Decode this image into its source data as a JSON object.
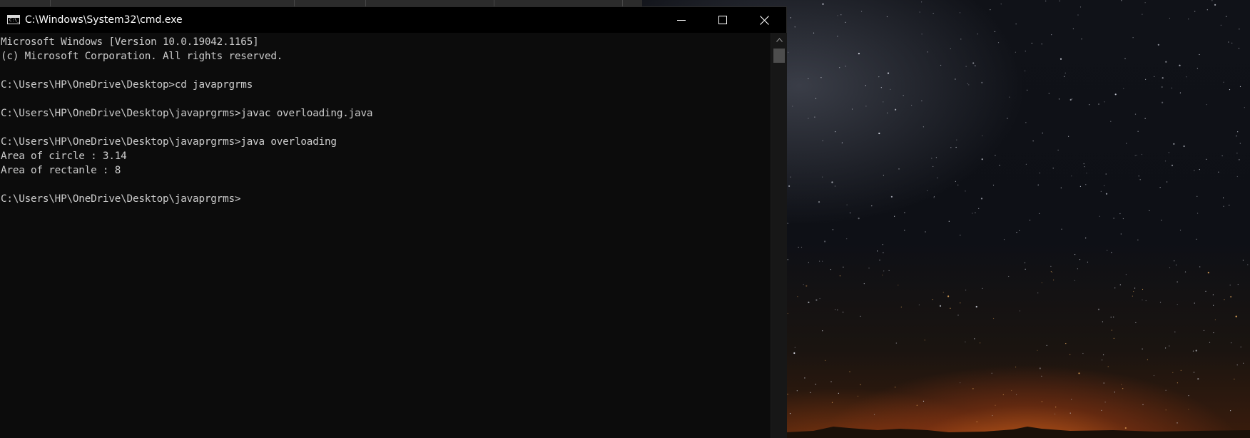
{
  "window": {
    "title": "C:\\Windows\\System32\\cmd.exe",
    "icon": "cmd-prompt-icon",
    "icon_glyph": "C:\\_",
    "controls": [
      "minimize-icon",
      "maximize-icon",
      "close-icon"
    ]
  },
  "console": {
    "lines": [
      "Microsoft Windows [Version 10.0.19042.1165]",
      "(c) Microsoft Corporation. All rights reserved.",
      "",
      "C:\\Users\\HP\\OneDrive\\Desktop>cd javaprgrms",
      "",
      "C:\\Users\\HP\\OneDrive\\Desktop\\javaprgrms>javac overloading.java",
      "",
      "C:\\Users\\HP\\OneDrive\\Desktop\\javaprgrms>java overloading",
      "Area of circle : 3.14",
      "Area of rectanle : 8",
      "",
      "C:\\Users\\HP\\OneDrive\\Desktop\\javaprgrms>"
    ]
  },
  "colors": {
    "console_bg": "#0c0c0c",
    "console_text": "#cccccc",
    "titlebar_bg": "#000000",
    "titlebar_text": "#ffffff",
    "scrollbar_track": "#171717",
    "scrollbar_thumb": "#4d4d4d"
  },
  "desktop": {
    "wallpaper": "night-sky-milky-way-wallpaper"
  }
}
